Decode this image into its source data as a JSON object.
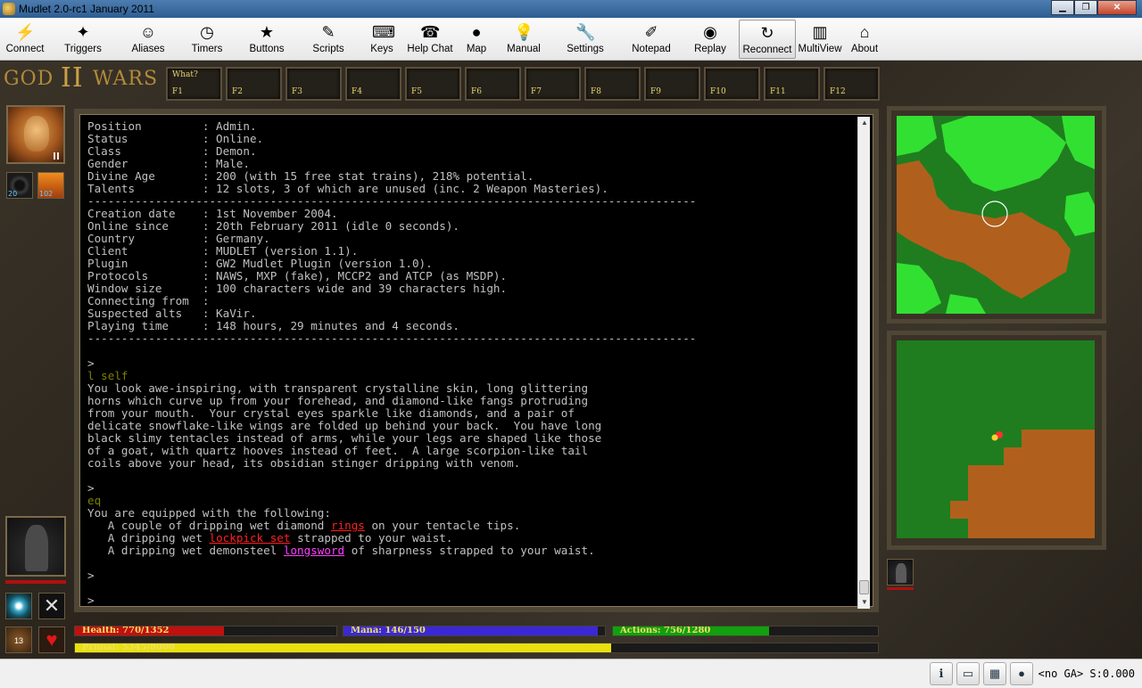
{
  "window": {
    "title": "Mudlet 2.0-rc1 January 2011",
    "min": "▁",
    "max": "❐",
    "close": "✕"
  },
  "toolbar": [
    {
      "label": "Connect",
      "icon": "⚡",
      "name": "connect"
    },
    {
      "label": "Triggers",
      "icon": "✦",
      "name": "triggers"
    },
    {
      "label": "Aliases",
      "icon": "☺",
      "name": "aliases"
    },
    {
      "label": "Timers",
      "icon": "◷",
      "name": "timers"
    },
    {
      "label": "Buttons",
      "icon": "★",
      "name": "buttons"
    },
    {
      "label": "Scripts",
      "icon": "✎",
      "name": "scripts"
    },
    {
      "label": "Keys",
      "icon": "⌨",
      "name": "keys"
    },
    {
      "label": "Help Chat",
      "icon": "☎",
      "name": "help-chat"
    },
    {
      "label": "Map",
      "icon": "●",
      "name": "map"
    },
    {
      "label": "Manual",
      "icon": "💡",
      "name": "manual"
    },
    {
      "label": "Settings",
      "icon": "🔧",
      "name": "settings"
    },
    {
      "label": "Notepad",
      "icon": "✐",
      "name": "notepad"
    },
    {
      "label": "Replay",
      "icon": "◉",
      "name": "replay"
    },
    {
      "label": "Reconnect",
      "icon": "↻",
      "name": "reconnect"
    },
    {
      "label": "MultiView",
      "icon": "▥",
      "name": "multiview"
    },
    {
      "label": "About",
      "icon": "⌂",
      "name": "about"
    }
  ],
  "logo": {
    "left": "GOD",
    "roman": "II",
    "right": "WARS"
  },
  "fkeys": [
    {
      "top": "What?",
      "cap": "F1"
    },
    {
      "top": "",
      "cap": "F2"
    },
    {
      "top": "",
      "cap": "F3"
    },
    {
      "top": "",
      "cap": "F4"
    },
    {
      "top": "",
      "cap": "F5"
    },
    {
      "top": "",
      "cap": "F6"
    },
    {
      "top": "",
      "cap": "F7"
    },
    {
      "top": "",
      "cap": "F8"
    },
    {
      "top": "",
      "cap": "F9"
    },
    {
      "top": "",
      "cap": "F10"
    },
    {
      "top": "",
      "cap": "F11"
    },
    {
      "top": "",
      "cap": "F12"
    }
  ],
  "left_panel": {
    "eye_value": "20",
    "rank_value": "102",
    "bag_value": "13"
  },
  "console": {
    "lines": [
      [
        {
          "t": "Position         : Admin."
        }
      ],
      [
        {
          "t": "Status           : Online."
        }
      ],
      [
        {
          "t": "Class            : Demon."
        }
      ],
      [
        {
          "t": "Gender           : Male."
        }
      ],
      [
        {
          "t": "Divine Age       : 200 (with 15 free stat trains), 218% potential."
        }
      ],
      [
        {
          "t": "Talents          : 12 slots, 3 of which are unused (inc. 2 Weapon Masteries)."
        }
      ],
      [
        {
          "t": "------------------------------------------------------------------------------------------"
        }
      ],
      [
        {
          "t": "Creation date    : 1st November 2004."
        }
      ],
      [
        {
          "t": "Online since     : 20th February 2011 (idle 0 seconds)."
        }
      ],
      [
        {
          "t": "Country          : Germany."
        }
      ],
      [
        {
          "t": "Client           : MUDLET (version 1.1)."
        }
      ],
      [
        {
          "t": "Plugin           : GW2 Mudlet Plugin (version 1.0)."
        }
      ],
      [
        {
          "t": "Protocols        : NAWS, MXP (fake), MCCP2 and ATCP (as MSDP)."
        }
      ],
      [
        {
          "t": "Window size      : 100 characters wide and 39 characters high."
        }
      ],
      [
        {
          "t": "Connecting from  :"
        }
      ],
      [
        {
          "t": "Suspected alts   : KaVir."
        }
      ],
      [
        {
          "t": "Playing time     : 148 hours, 29 minutes and 4 seconds."
        }
      ],
      [
        {
          "t": "------------------------------------------------------------------------------------------"
        }
      ],
      [
        {
          "t": ""
        }
      ],
      [
        {
          "t": ">"
        }
      ],
      [
        {
          "t": "l self",
          "c": "cmd"
        }
      ],
      [
        {
          "t": "You look awe-inspiring, with transparent crystalline skin, long glittering"
        }
      ],
      [
        {
          "t": "horns which curve up from your forehead, and diamond-like fangs protruding"
        }
      ],
      [
        {
          "t": "from your mouth.  Your crystal eyes sparkle like diamonds, and a pair of"
        }
      ],
      [
        {
          "t": "delicate snowflake-like wings are folded up behind your back.  You have long"
        }
      ],
      [
        {
          "t": "black slimy tentacles instead of arms, while your legs are shaped like those"
        }
      ],
      [
        {
          "t": "of a goat, with quartz hooves instead of feet.  A large scorpion-like tail"
        }
      ],
      [
        {
          "t": "coils above your head, its obsidian stinger dripping with venom."
        }
      ],
      [
        {
          "t": ""
        }
      ],
      [
        {
          "t": ">"
        }
      ],
      [
        {
          "t": "eq",
          "c": "cmd"
        }
      ],
      [
        {
          "t": "You are equipped with the following:"
        }
      ],
      [
        {
          "t": "   A couple of dripping wet diamond "
        },
        {
          "t": "rings",
          "c": "red"
        },
        {
          "t": " on your tentacle tips."
        }
      ],
      [
        {
          "t": "   A dripping wet "
        },
        {
          "t": "lockpick set",
          "c": "red"
        },
        {
          "t": " strapped to your waist."
        }
      ],
      [
        {
          "t": "   A dripping wet demonsteel "
        },
        {
          "t": "longsword",
          "c": "mag"
        },
        {
          "t": " of sharpness strapped to your waist."
        }
      ],
      [
        {
          "t": ""
        }
      ],
      [
        {
          "t": ">"
        }
      ],
      [
        {
          "t": ""
        }
      ],
      [
        {
          "t": ">"
        }
      ]
    ]
  },
  "bars": {
    "health": {
      "label": "Health: 770/1352",
      "value": 770,
      "max": 1352,
      "color": "#c01010"
    },
    "mana": {
      "label": "Mana: 146/150",
      "value": 146,
      "max": 150,
      "color": "#3a28d8"
    },
    "actions": {
      "label": "Actions: 756/1280",
      "value": 756,
      "max": 1280,
      "color": "#10a010"
    },
    "primal": {
      "label": "Primal: 5345/8000",
      "value": 5345,
      "max": 8000,
      "color": "#e8e010"
    }
  },
  "status": {
    "text": "<no GA> S:0.000"
  }
}
